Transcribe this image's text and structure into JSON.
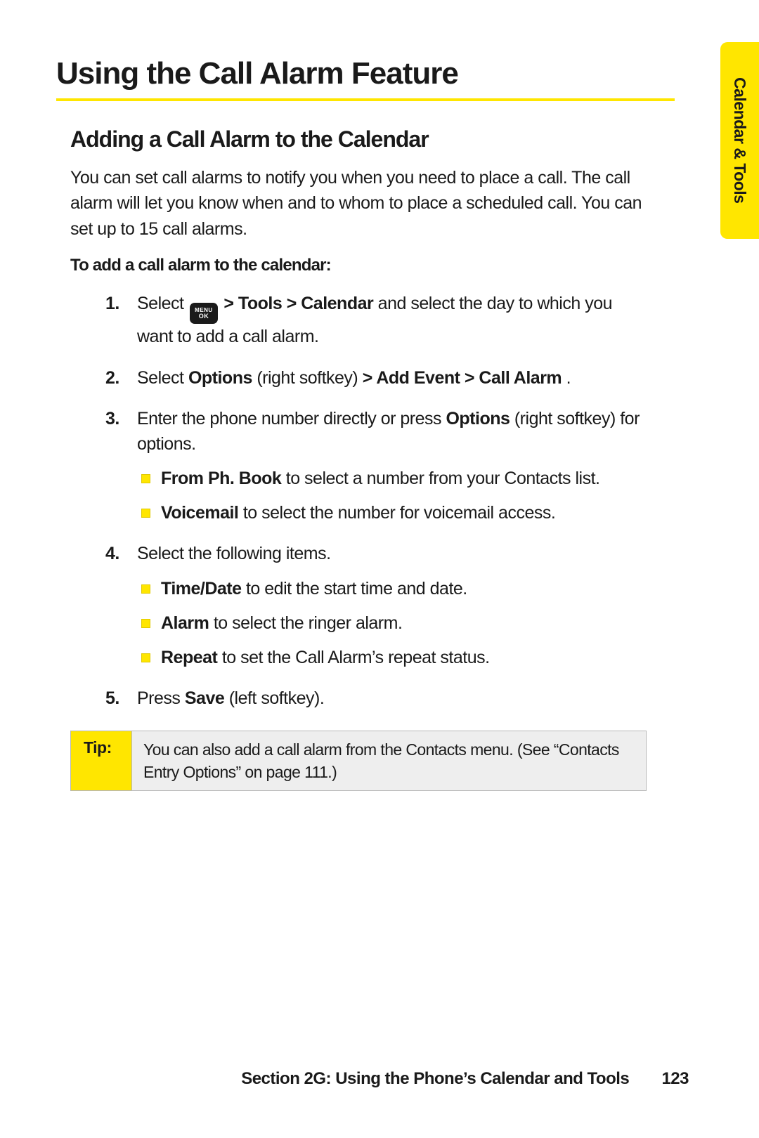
{
  "side_tab": "Calendar & Tools",
  "title": "Using the Call Alarm Feature",
  "subtitle": "Adding a Call Alarm to the Calendar",
  "intro": "You can set call alarms to notify you when you need to place a call. The call alarm will let you know when and to whom to place a scheduled call. You can set up to 15 call alarms.",
  "lead": "To add a call alarm to the calendar:",
  "key_icon": {
    "line1": "MENU",
    "line2": "OK"
  },
  "steps": {
    "s1": {
      "pre": "Select ",
      "bold_path": " > Tools > Calendar",
      "post": " and select the day to which you want to add a call alarm."
    },
    "s2": {
      "pre": "Select ",
      "b1": "Options",
      "mid": " (right softkey) ",
      "b2": "> Add Event > Call Alarm",
      "post": "."
    },
    "s3": {
      "pre": "Enter the phone number directly or press ",
      "b1": "Options",
      "post": " (right softkey) for options.",
      "bullets": [
        {
          "b": "From Ph. Book",
          "t": " to select a number from your Contacts list."
        },
        {
          "b": "Voicemail",
          "t": " to select the number for voicemail access."
        }
      ]
    },
    "s4": {
      "text": "Select the following items.",
      "bullets": [
        {
          "b": "Time/Date",
          "t": " to edit the start time and date."
        },
        {
          "b": "Alarm",
          "t": " to select the ringer alarm."
        },
        {
          "b": "Repeat",
          "t": " to set the Call Alarm’s repeat status."
        }
      ]
    },
    "s5": {
      "pre": "Press ",
      "b1": "Save",
      "post": " (left softkey)."
    }
  },
  "tip": {
    "label": "Tip:",
    "text": "You can also add a call alarm from the Contacts menu. (See “Contacts Entry Options” on page 111.)"
  },
  "footer": {
    "section": "Section 2G: Using the Phone’s Calendar and Tools",
    "page": "123"
  }
}
